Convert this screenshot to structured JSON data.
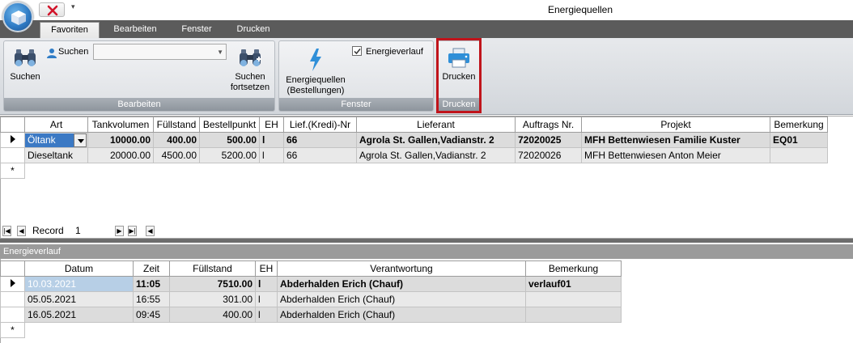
{
  "window": {
    "title": "Energiequellen"
  },
  "ribbon": {
    "tabs": [
      {
        "label": "Favoriten",
        "active": true
      },
      {
        "label": "Bearbeiten",
        "active": false
      },
      {
        "label": "Fenster",
        "active": false
      },
      {
        "label": "Drucken",
        "active": false
      }
    ],
    "groups": {
      "bearbeiten": {
        "label": "Bearbeiten",
        "search_button": "Suchen",
        "search_label": "Suchen",
        "search_value": "",
        "continue_line1": "Suchen",
        "continue_line2": "fortsetzen"
      },
      "fenster": {
        "label": "Fenster",
        "energy_line1": "Energiequellen",
        "energy_line2": "(Bestellungen)",
        "checkbox_label": "Energieverlauf",
        "checkbox_checked": true
      },
      "drucken": {
        "label": "Drucken",
        "print_button": "Drucken"
      }
    }
  },
  "upper_grid": {
    "columns": [
      "Art",
      "Tankvolumen",
      "Füllstand",
      "Bestellpunkt",
      "EH",
      "Lief.(Kredi)-Nr",
      "Lieferant",
      "Auftrags Nr.",
      "Projekt",
      "Bemerkung"
    ],
    "rows": [
      {
        "art": "Öltank",
        "tankvolumen": "10000.00",
        "fuellstand": "400.00",
        "bestellpunkt": "500.00",
        "eh": "l",
        "lief": "66",
        "lieferant": "Agrola St. Gallen,Vadianstr. 2",
        "auftrag": "72020025",
        "projekt": "MFH Bettenwiesen Familie Kuster",
        "bemerkung": "EQ01"
      },
      {
        "art": "Dieseltank",
        "tankvolumen": "20000.00",
        "fuellstand": "4500.00",
        "bestellpunkt": "5200.00",
        "eh": "l",
        "lief": "66",
        "lieferant": "Agrola St. Gallen,Vadianstr. 2",
        "auftrag": "72020026",
        "projekt": "MFH Bettenwiesen Anton Meier",
        "bemerkung": ""
      }
    ],
    "new_row_marker": "*"
  },
  "navigator": {
    "record_label": "Record",
    "record_value": "1",
    "first": "|◀",
    "prev": "◀",
    "next": "▶",
    "last": "▶|",
    "new": "◀"
  },
  "sub_form": {
    "title": "Energieverlauf"
  },
  "lower_grid": {
    "columns": [
      "Datum",
      "Zeit",
      "Füllstand",
      "EH",
      "Verantwortung",
      "Bemerkung"
    ],
    "rows": [
      {
        "datum": "10.03.2021",
        "zeit": "11:05",
        "fuellstand": "7510.00",
        "eh": "l",
        "verantwortung": "Abderhalden Erich (Chauf)",
        "bemerkung": "verlauf01"
      },
      {
        "datum": "05.05.2021",
        "zeit": "16:55",
        "fuellstand": "301.00",
        "eh": "l",
        "verantwortung": "Abderhalden Erich (Chauf)",
        "bemerkung": ""
      },
      {
        "datum": "16.05.2021",
        "zeit": "09:45",
        "fuellstand": "400.00",
        "eh": "l",
        "verantwortung": "Abderhalden Erich (Chauf)",
        "bemerkung": ""
      }
    ],
    "new_row_marker": "*"
  },
  "colors": {
    "selection": "#3b79c4",
    "highlight_frame": "#c0141b",
    "tabbar": "#5b5b5b"
  }
}
